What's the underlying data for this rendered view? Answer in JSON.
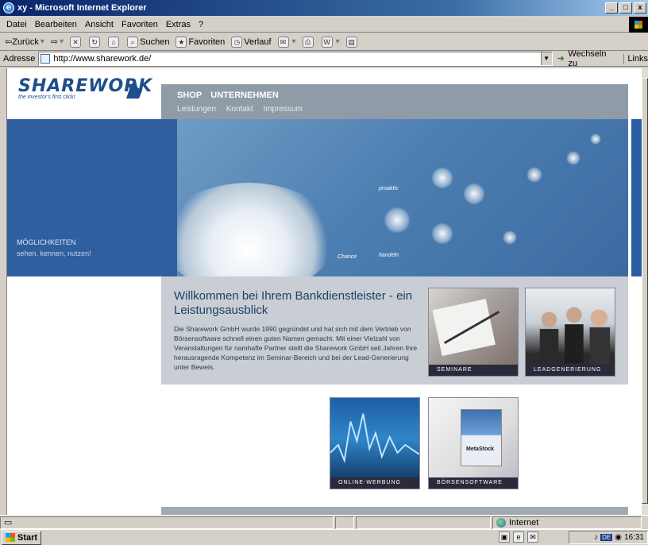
{
  "window": {
    "title": "xy - Microsoft Internet Explorer"
  },
  "menu": [
    "Datei",
    "Bearbeiten",
    "Ansicht",
    "Favoriten",
    "Extras",
    "?"
  ],
  "toolbar": {
    "back": "Zurück",
    "search": "Suchen",
    "favorites": "Favoriten",
    "history": "Verlauf"
  },
  "address": {
    "label": "Adresse",
    "url": "http://www.sharework.de/",
    "go": "Wechseln zu",
    "links": "Links"
  },
  "site": {
    "logo_word": "SHAREWORK",
    "logo_tagline": "the investor's first click!",
    "nav_main": [
      "SHOP",
      "UNTERNEHMEN"
    ],
    "nav_sub": [
      "Leistungen",
      "Kontakt",
      "Impressum"
    ],
    "hero_left_title": "MÖGLICHKEITEN",
    "hero_left_sub": "sehen, kennen, nutzen!",
    "hero_labels": [
      "proaktiv",
      "Chance",
      "handeln"
    ],
    "welcome_title": "Willkommen bei Ihrem Bankdienstleister - ein Leistungsausblick",
    "welcome_text": "Die Sharework GmbH wurde 1990 gegründet und hat sich mit dem Vertrieb von Börsensoftware schnell einen guten Namen gemacht. Mit einer Vielzahl von Veranstaltungen für namhafte Partner stellt die Sharework GmbH seit Jahren Ihre herausragende Kompetenz im Seminar-Bereich und bei der Lead-Generierung unter Beweis.",
    "tiles": {
      "seminare": "SEMINARE",
      "lead": "LEADGENERIERUNG",
      "online": "ONLINE-WERBUNG",
      "boerse": "BÖRSENSOFTWARE",
      "boerse_product": "MetaStock"
    }
  },
  "status": {
    "zone": "Internet"
  },
  "taskbar": {
    "start": "Start",
    "lang": "DE",
    "clock": "16:31"
  }
}
